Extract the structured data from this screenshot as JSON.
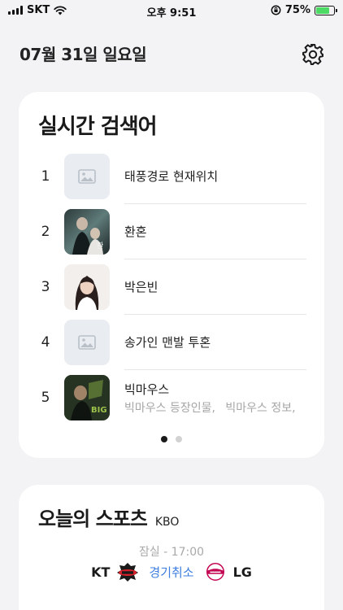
{
  "status_bar": {
    "carrier": "SKT",
    "time": "오후 9:51",
    "battery": "75%",
    "battery_level": 0.75
  },
  "header": {
    "date": "07월 31일 일요일",
    "settings_icon": "gear-icon"
  },
  "trending": {
    "title": "실시간 검색어",
    "items": [
      {
        "rank": "1",
        "title": "태풍경로 현재위치",
        "thumb": "placeholder"
      },
      {
        "rank": "2",
        "title": "환혼",
        "thumb": "photo"
      },
      {
        "rank": "3",
        "title": "박은빈",
        "thumb": "photo"
      },
      {
        "rank": "4",
        "title": "송가인 맨발 투혼",
        "thumb": "placeholder"
      },
      {
        "rank": "5",
        "title": "빅마우스",
        "thumb": "photo",
        "related": [
          "빅마우스 등장인물,",
          "빅마우스 정보,"
        ]
      }
    ],
    "page_count": 2,
    "active_page": 1
  },
  "sports": {
    "title": "오늘의 스포츠",
    "league": "KBO",
    "match": {
      "venue_time": "잠실 - 17:00",
      "home": "KT",
      "status": "경기취소",
      "away": "LG"
    }
  },
  "colors": {
    "accent": "#3d7ee0",
    "background": "#f3f3f6",
    "battery": "#4cd964"
  }
}
